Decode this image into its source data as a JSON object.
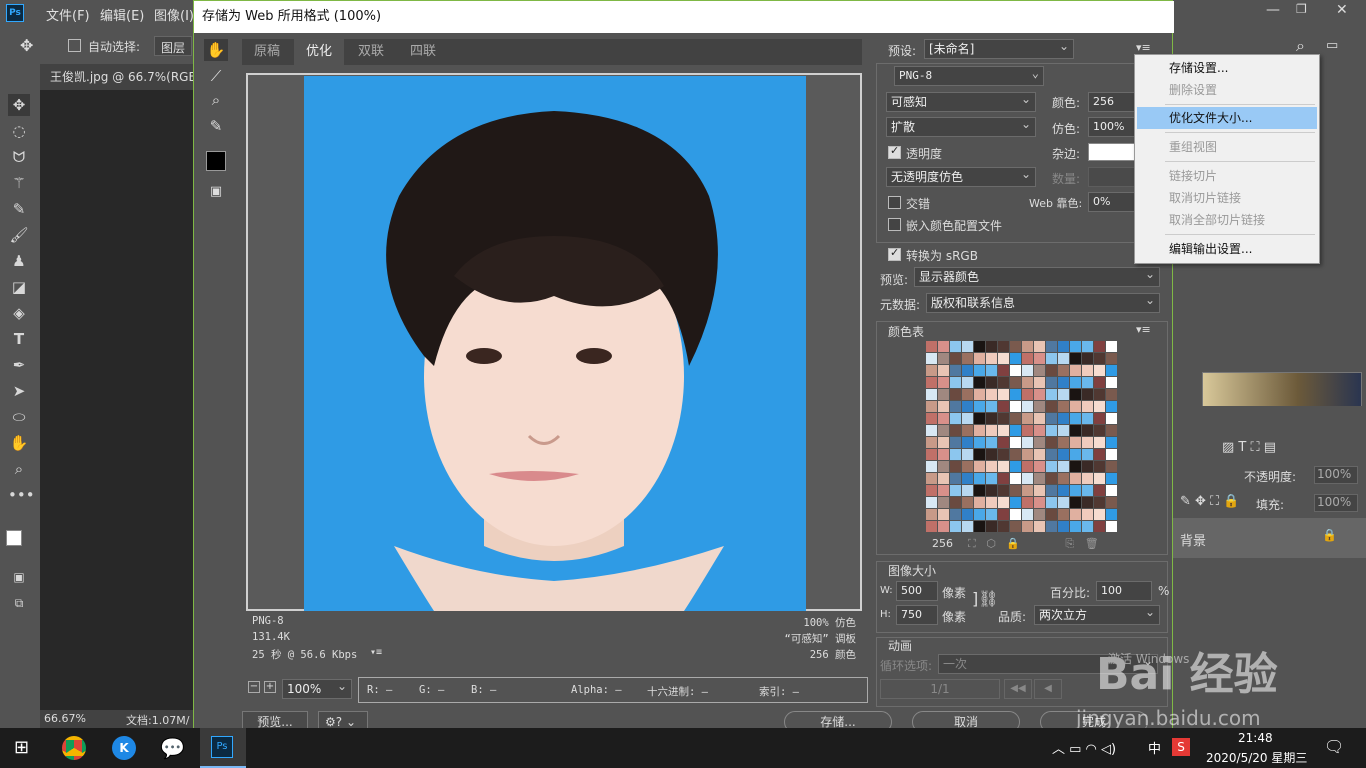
{
  "ps": {
    "logo": "Ps",
    "menu": [
      "文件(F)",
      "编辑(E)",
      "图像(I)"
    ],
    "options": {
      "auto_select": "自动选择:",
      "layer_select": "图层"
    },
    "doc_tab": "王俊凯.jpg @ 66.7%(RGB/",
    "status_zoom": "66.67%",
    "status_doc": "文档:1.07M/"
  },
  "dialog": {
    "title": "存储为 Web 所用格式 (100%)",
    "tabs": [
      "原稿",
      "优化",
      "双联",
      "四联"
    ],
    "active_tab": "优化",
    "info_left": [
      "PNG-8",
      "131.4K",
      "25 秒 @ 56.6 Kbps"
    ],
    "info_right": [
      "100% 仿色",
      "“可感知” 调板",
      "256 颜色"
    ],
    "zoom": "100%",
    "readout": {
      "r": "R: —",
      "g": "G: —",
      "b": "B: —",
      "alpha": "Alpha: —",
      "hex": "十六进制: —",
      "index": "索引: —"
    },
    "buttons": {
      "preview": "预览...",
      "save": "存储...",
      "cancel": "取消",
      "done": "完成"
    }
  },
  "settings": {
    "preset_label": "预设:",
    "preset_value": "[未命名]",
    "format": "PNG-8",
    "reduction": "可感知",
    "dither_algo": "扩散",
    "transparency": "透明度",
    "transparency_checked": true,
    "trans_dither": "无透明度仿色",
    "interlaced": "交错",
    "interlaced_checked": false,
    "embed_profile": "嵌入颜色配置文件",
    "embed_checked": false,
    "colors_label": "颜色:",
    "colors_value": "256",
    "dither_label": "仿色:",
    "dither_value": "100%",
    "matte_label": "杂边:",
    "amount_label": "数量:",
    "web_snap_label": "Web 靠色:",
    "web_snap_value": "0%",
    "convert_srgb": "转换为 sRGB",
    "convert_checked": true,
    "preview_label": "预览:",
    "preview_value": "显示器颜色",
    "metadata_label": "元数据:",
    "metadata_value": "版权和联系信息",
    "color_table_label": "颜色表",
    "color_count": "256",
    "image_size_label": "图像大小",
    "w_label": "W:",
    "w_value": "500",
    "h_label": "H:",
    "h_value": "750",
    "px_unit": "像素",
    "percent_label": "百分比:",
    "percent_value": "100",
    "percent_sign": "%",
    "quality_label": "品质:",
    "quality_value": "两次立方",
    "animation_label": "动画",
    "loop_label": "循环选项:",
    "loop_value": "一次",
    "frame": "1/1"
  },
  "context_menu": {
    "items": [
      {
        "label": "存储设置...",
        "enabled": true,
        "highlighted": false
      },
      {
        "label": "删除设置",
        "enabled": false,
        "highlighted": false
      },
      {
        "label": "优化文件大小...",
        "enabled": true,
        "highlighted": true
      },
      {
        "label": "重组视图",
        "enabled": false,
        "highlighted": false
      },
      {
        "label": "链接切片",
        "enabled": false,
        "highlighted": false
      },
      {
        "label": "取消切片链接",
        "enabled": false,
        "highlighted": false
      },
      {
        "label": "取消全部切片链接",
        "enabled": false,
        "highlighted": false
      },
      {
        "label": "编辑输出设置...",
        "enabled": true,
        "highlighted": false
      }
    ]
  },
  "layers_panel": {
    "opacity_label": "不透明度:",
    "opacity_value": "100%",
    "fill_label": "填充:",
    "fill_value": "100%",
    "layer_name": "背景"
  },
  "taskbar": {
    "ime": "中",
    "time": "21:48",
    "date": "2020/5/20 星期三"
  },
  "watermark": {
    "text": "Bai 经验",
    "url": "jingyan.baidu.com",
    "activate": "激活 Windows"
  },
  "colors": {
    "photo_bg": "#2f9be5",
    "highlight": "#99c9f5",
    "dialog_border": "#7fb845"
  }
}
